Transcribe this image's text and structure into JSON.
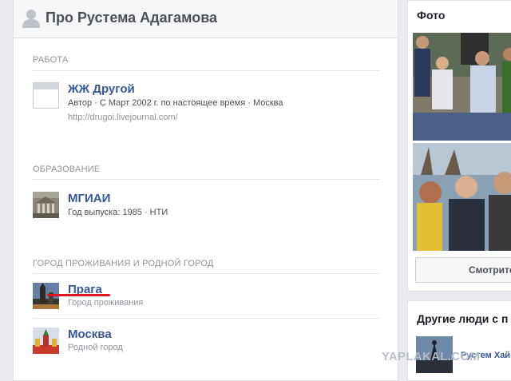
{
  "header": {
    "title": "Про Рустема Адагамова",
    "icon": "person-icon"
  },
  "work": {
    "section_label": "РАБОТА",
    "entry": {
      "title": "ЖЖ Другой",
      "details": "Автор · С Март 2002 г. по настоящее время · Москва",
      "link": "http://drugoi.livejournal.com/"
    }
  },
  "education": {
    "section_label": "ОБРАЗОВАНИЕ",
    "entry": {
      "title": "МГИАИ",
      "details": "Год выпуска: 1985 · НТИ"
    }
  },
  "places": {
    "section_label": "ГОРОД ПРОЖИВАНИЯ И РОДНОЙ ГОРОД",
    "current": {
      "title": "Прага",
      "details": "Город проживания"
    },
    "hometown": {
      "title": "Москва",
      "details": "Родной город"
    }
  },
  "photos": {
    "title": "Фото",
    "see_all_label": "Смотрите"
  },
  "people": {
    "title": "Другие люди с п",
    "first_name": "Рустем Хай"
  },
  "watermark": {
    "text": "YAPLAKAL.COM"
  },
  "colors": {
    "link": "#365899",
    "accent_underline": "#e0141e",
    "page_bg": "#e9ebee"
  }
}
